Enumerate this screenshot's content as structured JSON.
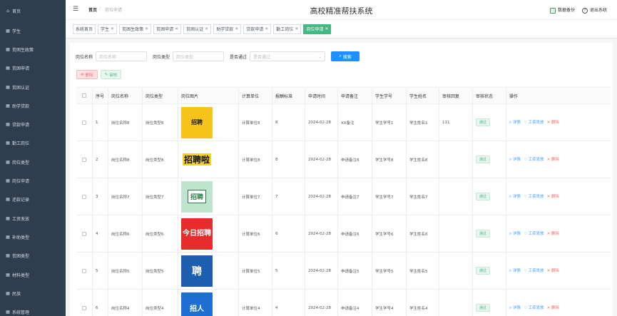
{
  "sidebar": {
    "items": [
      {
        "label": "首页",
        "icon": "home-icon"
      },
      {
        "label": "学生",
        "icon": "grid-icon"
      },
      {
        "label": "贫困生政策",
        "icon": "grid-icon"
      },
      {
        "label": "贫困申请",
        "icon": "grid-icon"
      },
      {
        "label": "贫困认证",
        "icon": "grid-icon"
      },
      {
        "label": "助学贷款",
        "icon": "grid-icon"
      },
      {
        "label": "贷款申请",
        "icon": "grid-icon"
      },
      {
        "label": "勤工岗位",
        "icon": "grid-icon"
      },
      {
        "label": "岗位类型",
        "icon": "grid-icon"
      },
      {
        "label": "岗位申请",
        "icon": "grid-icon"
      },
      {
        "label": "还款记录",
        "icon": "grid-icon"
      },
      {
        "label": "工资发放",
        "icon": "grid-icon"
      },
      {
        "label": "补助类型",
        "icon": "grid-icon"
      },
      {
        "label": "贫困类型",
        "icon": "grid-icon"
      },
      {
        "label": "材料类型",
        "icon": "grid-icon"
      },
      {
        "label": "民族",
        "icon": "grid-icon"
      },
      {
        "label": "系统管理",
        "icon": "grid-icon"
      }
    ]
  },
  "header": {
    "breadcrumb_home": "首页",
    "breadcrumb_sep": "/",
    "breadcrumb_current": "岗位申请",
    "title": "高校精准帮扶系统",
    "backup_label": "数据备份",
    "logout_label": "退出系统"
  },
  "tags": [
    {
      "label": "系统首页",
      "closable": false,
      "active": false
    },
    {
      "label": "学生",
      "closable": true,
      "active": false
    },
    {
      "label": "贫困生政策",
      "closable": true,
      "active": false
    },
    {
      "label": "贫困申请",
      "closable": true,
      "active": false
    },
    {
      "label": "贫困认证",
      "closable": true,
      "active": false
    },
    {
      "label": "助学贷款",
      "closable": true,
      "active": false
    },
    {
      "label": "贷款申请",
      "closable": true,
      "active": false
    },
    {
      "label": "勤工岗位",
      "closable": true,
      "active": false
    },
    {
      "label": "岗位申请",
      "closable": true,
      "active": true
    }
  ],
  "search": {
    "name_label": "岗位名称",
    "name_placeholder": "岗位名称",
    "type_label": "岗位类型",
    "type_placeholder": "岗位类型",
    "pass_label": "是否通过",
    "pass_placeholder": "是否通过",
    "button_label": "搜索"
  },
  "actions": {
    "delete_label": "删除",
    "audit_label": "审核"
  },
  "table": {
    "columns": [
      "序号",
      "岗位名称",
      "岗位类型",
      "岗位图片",
      "计算单位",
      "报酬标准",
      "申请时间",
      "申请备注",
      "学生学号",
      "学生姓名",
      "审核回复",
      "审核状态",
      "操作"
    ],
    "op_detail": "详情",
    "op_pay": "工资发放",
    "op_delete": "删除",
    "rows": [
      {
        "no": "1",
        "name": "岗位名称8",
        "type": "岗位类型8",
        "img": "招聘",
        "unit": "计算单位8",
        "rate": "8",
        "time": "2024-02-28",
        "remark": "XX备注",
        "sid": "学生学号1",
        "sname": "学生姓名1",
        "reply": "111",
        "status": "通过"
      },
      {
        "no": "2",
        "name": "岗位名称8",
        "type": "岗位类型8",
        "img": "招聘啦",
        "unit": "计算单位8",
        "rate": "8",
        "time": "2024-02-28",
        "remark": "申请备注8",
        "sid": "学生学号8",
        "sname": "学生姓名8",
        "reply": "",
        "status": "通过"
      },
      {
        "no": "3",
        "name": "岗位名称7",
        "type": "岗位类型7",
        "img": "招聘",
        "unit": "计算单位7",
        "rate": "7",
        "time": "2024-02-28",
        "remark": "申请备注7",
        "sid": "学生学号7",
        "sname": "学生姓名7",
        "reply": "",
        "status": "通过"
      },
      {
        "no": "4",
        "name": "岗位名称6",
        "type": "岗位类型6",
        "img": "今日招聘",
        "unit": "计算单位6",
        "rate": "6",
        "time": "2024-02-28",
        "remark": "申请备注6",
        "sid": "学生学号6",
        "sname": "学生姓名6",
        "reply": "",
        "status": "通过"
      },
      {
        "no": "5",
        "name": "岗位名称5",
        "type": "岗位类型5",
        "img": "聘",
        "unit": "计算单位5",
        "rate": "5",
        "time": "2024-02-28",
        "remark": "申请备注5",
        "sid": "学生学号5",
        "sname": "学生姓名5",
        "reply": "",
        "status": "通过"
      },
      {
        "no": "6",
        "name": "岗位名称4",
        "type": "岗位类型4",
        "img": "招人",
        "unit": "计算单位4",
        "rate": "4",
        "time": "2024-02-28",
        "remark": "申请备注4",
        "sid": "学生学号4",
        "sname": "学生姓名4",
        "reply": "",
        "status": "通过"
      }
    ]
  }
}
